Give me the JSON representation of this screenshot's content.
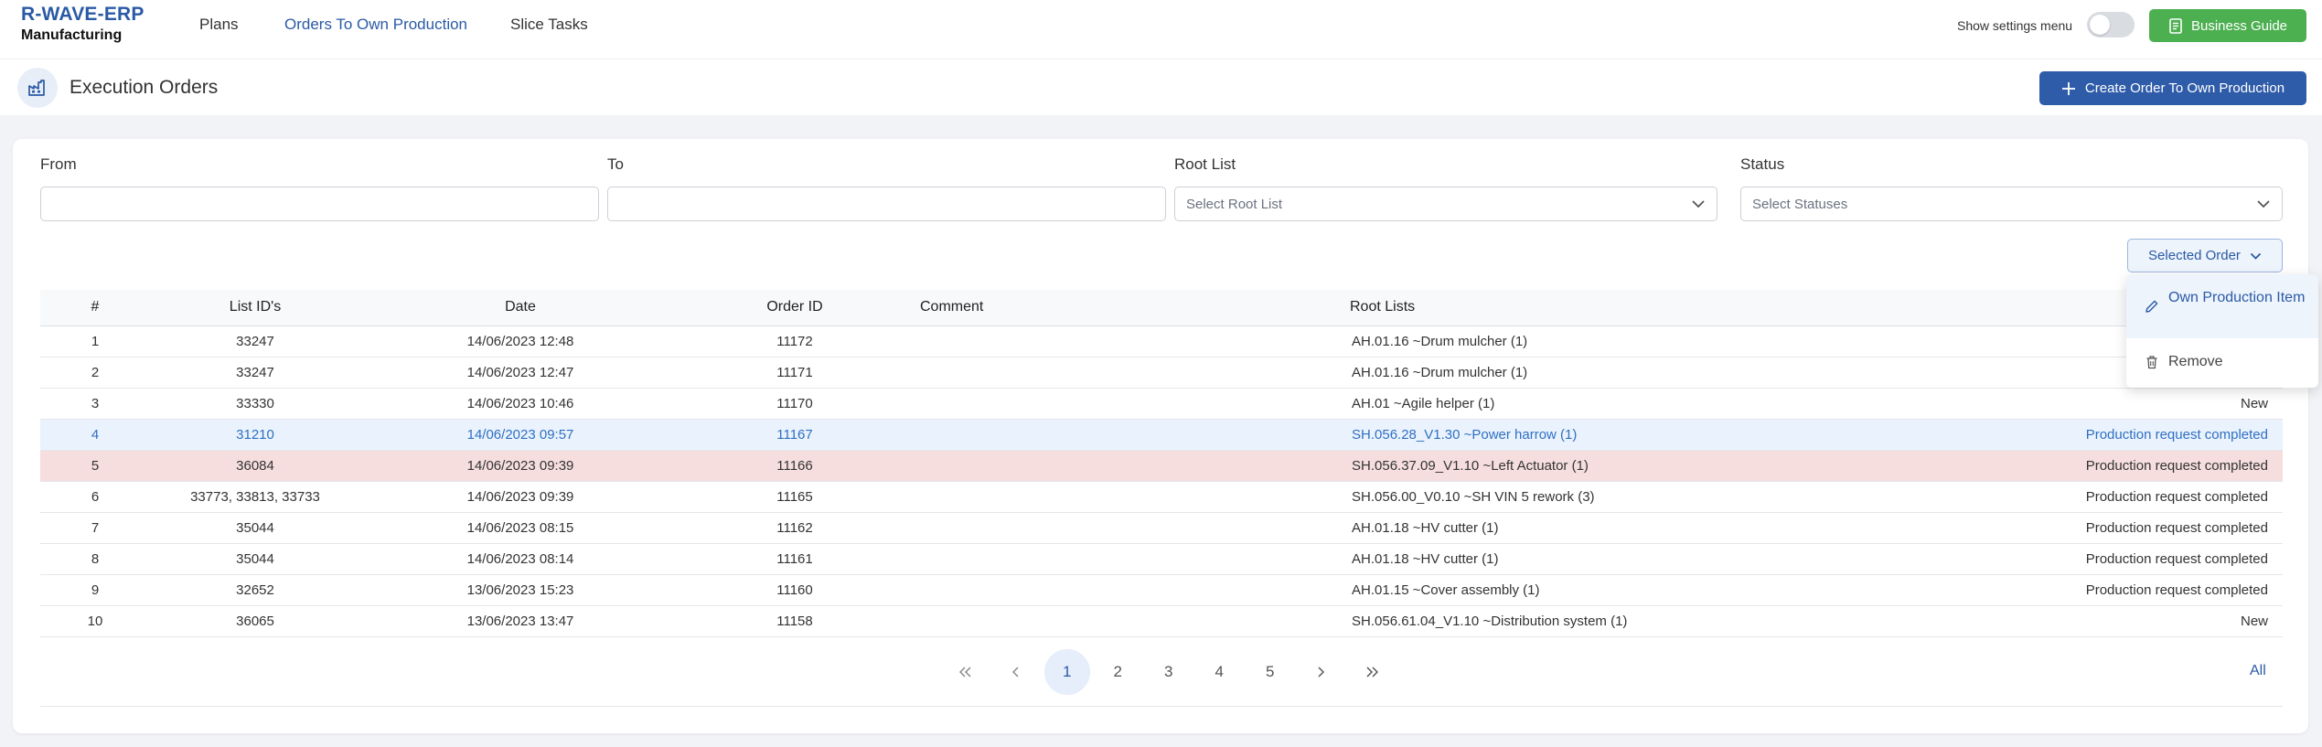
{
  "brand": {
    "title": "R-WAVE-ERP",
    "subtitle": "Manufacturing"
  },
  "nav": {
    "plans": "Plans",
    "orders": "Orders To Own Production",
    "slice": "Slice Tasks"
  },
  "settings": {
    "label": "Show settings menu"
  },
  "guide_button": "Business Guide",
  "page": {
    "title": "Execution Orders",
    "create_button": "Create Order To Own Production"
  },
  "filters": {
    "from_label": "From",
    "to_label": "To",
    "root_label": "Root List",
    "root_placeholder": "Select Root List",
    "status_label": "Status",
    "status_placeholder": "Select Statuses"
  },
  "selected_order_button": "Selected Order",
  "table": {
    "headers": [
      "#",
      "List ID's",
      "Date",
      "Order ID",
      "Comment",
      "Root Lists",
      ""
    ],
    "rows": [
      [
        "1",
        "33247",
        "14/06/2023 12:48",
        "11172",
        "",
        "AH.01.16 ~Drum mulcher (1)",
        ""
      ],
      [
        "2",
        "33247",
        "14/06/2023 12:47",
        "11171",
        "",
        "AH.01.16 ~Drum mulcher (1)",
        ""
      ],
      [
        "3",
        "33330",
        "14/06/2023 10:46",
        "11170",
        "",
        "AH.01 ~Agile helper (1)",
        "New"
      ],
      [
        "4",
        "31210",
        "14/06/2023 09:57",
        "11167",
        "",
        "SH.056.28_V1.30 ~Power harrow (1)",
        "Production request completed"
      ],
      [
        "5",
        "36084",
        "14/06/2023 09:39",
        "11166",
        "",
        "SH.056.37.09_V1.10 ~Left Actuator (1)",
        "Production request completed"
      ],
      [
        "6",
        "33773, 33813, 33733",
        "14/06/2023 09:39",
        "11165",
        "",
        "SH.056.00_V0.10 ~SH VIN 5 rework (3)",
        "Production request completed"
      ],
      [
        "7",
        "35044",
        "14/06/2023 08:15",
        "11162",
        "",
        "AH.01.18 ~HV cutter (1)",
        "Production request completed"
      ],
      [
        "8",
        "35044",
        "14/06/2023 08:14",
        "11161",
        "",
        "AH.01.18 ~HV cutter (1)",
        "Production request completed"
      ],
      [
        "9",
        "32652",
        "13/06/2023 15:23",
        "11160",
        "",
        "AH.01.15 ~Cover assembly (1)",
        "Production request completed"
      ],
      [
        "10",
        "36065",
        "13/06/2023 13:47",
        "11158",
        "",
        "SH.056.61.04_V1.10 ~Distribution system (1)",
        "New"
      ]
    ]
  },
  "pagination": {
    "pages": [
      "1",
      "2",
      "3",
      "4",
      "5"
    ],
    "current": "1",
    "all": "All"
  },
  "dropdown": {
    "item1": "Own Production Item",
    "item2": "Remove"
  },
  "colors": {
    "brand_blue": "#2a5aa5",
    "green": "#4caf50",
    "button_blue": "#2f5ca9",
    "row_highlight_blue": "#eaf3fd",
    "row_highlight_red": "#f6dede"
  }
}
